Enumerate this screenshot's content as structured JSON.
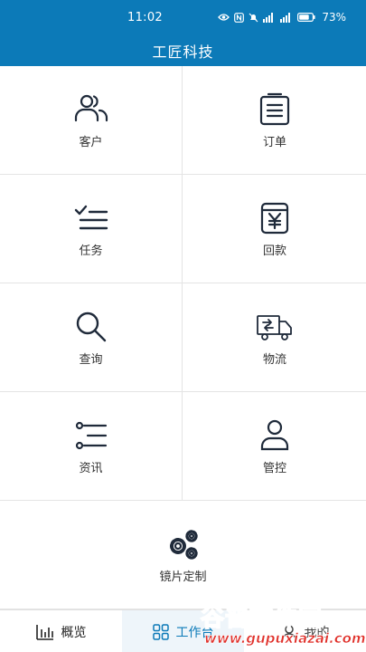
{
  "status": {
    "time": "11:02",
    "battery": "73%"
  },
  "header": {
    "title": "工匠科技"
  },
  "menu": [
    {
      "label": "客户",
      "icon": "users-icon"
    },
    {
      "label": "订单",
      "icon": "clipboard-icon"
    },
    {
      "label": "任务",
      "icon": "checklist-icon"
    },
    {
      "label": "回款",
      "icon": "yuan-receipt-icon"
    },
    {
      "label": "查询",
      "icon": "search-icon"
    },
    {
      "label": "物流",
      "icon": "truck-icon"
    },
    {
      "label": "资讯",
      "icon": "list-icon"
    },
    {
      "label": "管控",
      "icon": "user-icon"
    },
    {
      "label": "镜片定制",
      "icon": "gears-icon"
    }
  ],
  "tabs": [
    {
      "label": "概览",
      "icon": "bar-chart-icon"
    },
    {
      "label": "工作台",
      "icon": "grid-icon",
      "active": true
    },
    {
      "label": "我的",
      "icon": "profile-icon"
    }
  ],
  "watermark": {
    "big": "谷普软件园",
    "small": "www.gupuxiazai.com"
  },
  "colors": {
    "primary": "#0c7ab8",
    "icon": "#1f2a3a"
  }
}
